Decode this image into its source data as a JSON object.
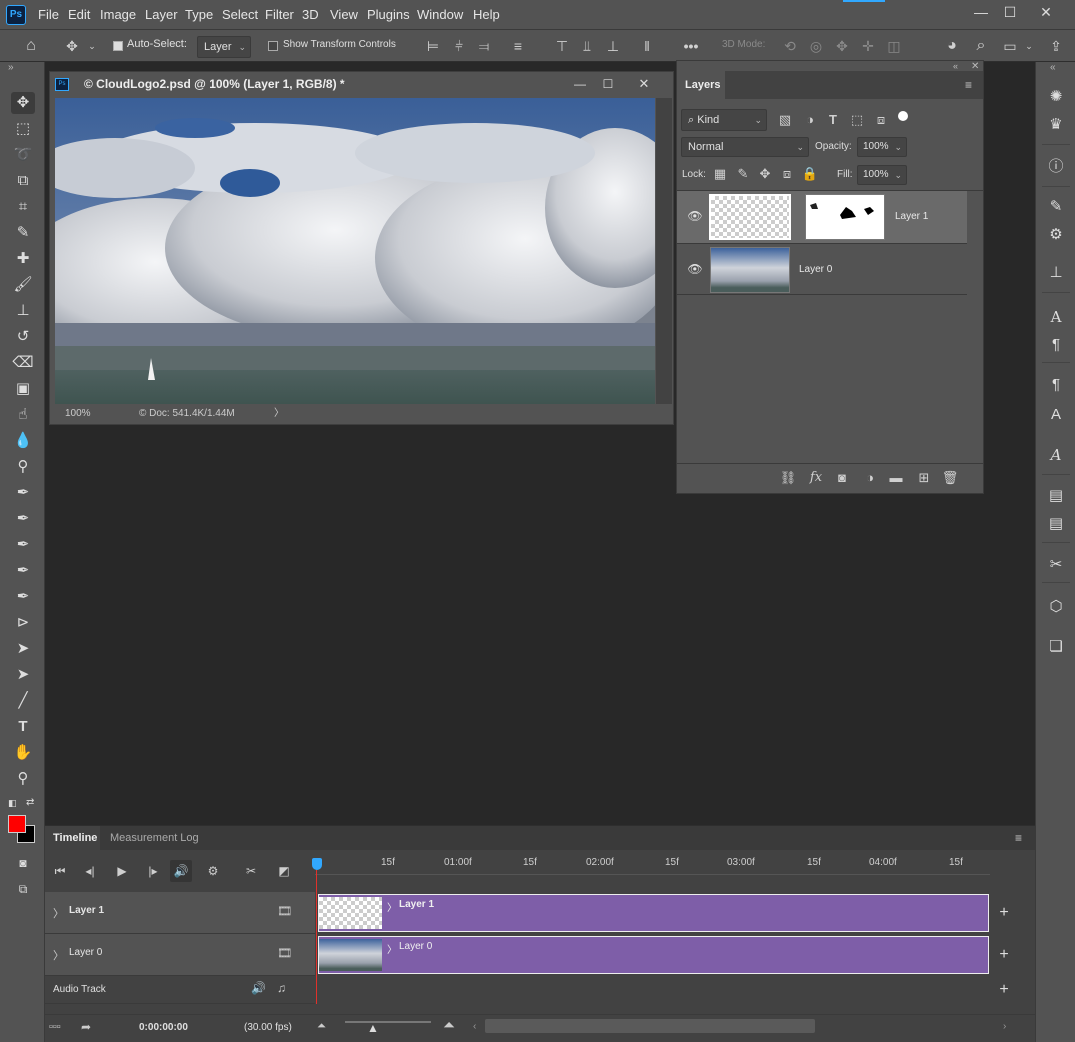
{
  "app": {
    "logo": "Ps"
  },
  "menu": [
    "File",
    "Edit",
    "Image",
    "Layer",
    "Type",
    "Select",
    "Filter",
    "3D",
    "View",
    "Plugins",
    "Window",
    "Help"
  ],
  "window_controls": {
    "minimize": "—",
    "maximize": "☐",
    "close": "✕"
  },
  "options_bar": {
    "auto_select_label": "Auto-Select:",
    "auto_select_checked": true,
    "auto_select_target": "Layer",
    "show_transform_label": "Show Transform Controls",
    "show_transform_checked": false,
    "more": "•••",
    "mode_3d_label": "3D Mode:"
  },
  "document": {
    "title": "© CloudLogo2.psd @ 100% (Layer 1, RGB/8) *",
    "zoom": "100%",
    "doc_info": "© Doc: 541.4K/1.44M",
    "arrow": "〉"
  },
  "layers_panel": {
    "tab": "Layers",
    "kind_filter": "Kind",
    "blend_mode": "Normal",
    "opacity_label": "Opacity:",
    "opacity_value": "100%",
    "lock_label": "Lock:",
    "fill_label": "Fill:",
    "fill_value": "100%",
    "layers": [
      {
        "name": "Layer 1",
        "visible": true,
        "selected": true,
        "has_mask": true
      },
      {
        "name": "Layer 0",
        "visible": true,
        "selected": false,
        "has_mask": false
      }
    ],
    "footer_icons": [
      "link-icon",
      "fx-icon",
      "mask-icon",
      "adjustment-icon",
      "folder-icon",
      "new-layer-icon",
      "trash-icon"
    ],
    "fx_label": "fx"
  },
  "timeline": {
    "tabs": [
      "Timeline",
      "Measurement Log"
    ],
    "ruler": [
      "15f",
      "01:00f",
      "15f",
      "02:00f",
      "15f",
      "03:00f",
      "15f",
      "04:00f",
      "15f"
    ],
    "tracks": [
      {
        "name": "Layer 1",
        "clip_label": "Layer 1"
      },
      {
        "name": "Layer 0",
        "clip_label": "Layer 0"
      }
    ],
    "audio_track": "Audio Track",
    "timecode": "0:00:00:00",
    "fps": "(30.00 fps)",
    "chevron": "〉",
    "plus": "+"
  },
  "colors": {
    "foreground": "#ff0000",
    "background": "#000000",
    "clip": "#7e5ea8",
    "accent": "#31a8ff"
  }
}
